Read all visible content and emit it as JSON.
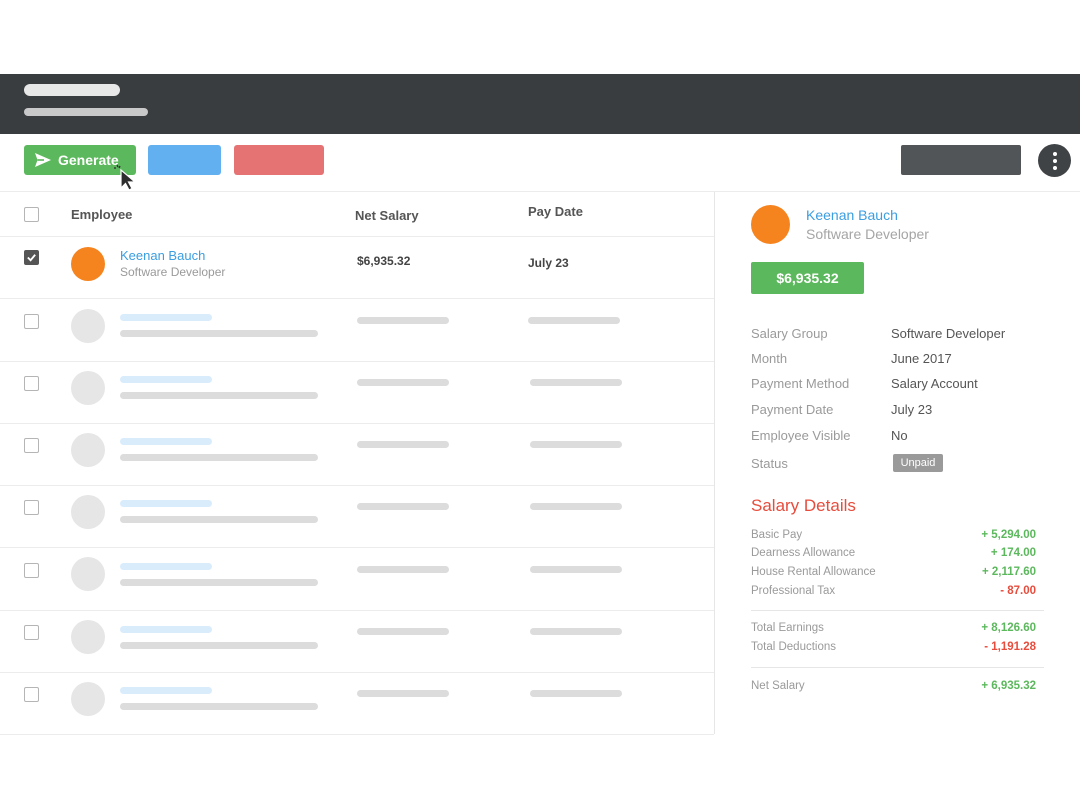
{
  "toolbar": {
    "generate_label": "Generate",
    "primary_color": "#5cb85c",
    "secondary_color": "#62b0f0",
    "danger_color": "#e57373"
  },
  "table": {
    "headers": {
      "employee": "Employee",
      "net_salary": "Net Salary",
      "pay_date": "Pay Date"
    },
    "selected_row": {
      "name": "Keenan Bauch",
      "role": "Software Developer",
      "net_salary": "$6,935.32",
      "pay_date": "July 23",
      "checked": true
    }
  },
  "detail": {
    "name": "Keenan Bauch",
    "role": "Software Developer",
    "amount": "$6,935.32",
    "info": [
      {
        "label": "Salary Group",
        "value": "Software Developer"
      },
      {
        "label": "Month",
        "value": "June 2017"
      },
      {
        "label": "Payment Method",
        "value": "Salary Account"
      },
      {
        "label": "Payment Date",
        "value": "July 23"
      },
      {
        "label": "Employee Visible",
        "value": "No"
      },
      {
        "label": "Status",
        "value": "Unpaid"
      }
    ],
    "salary_details_title": "Salary Details",
    "earnings": [
      {
        "label": "Basic Pay",
        "value": "+ 5,294.00"
      },
      {
        "label": "Dearness Allowance",
        "value": "+ 174.00"
      },
      {
        "label": "House Rental Allowance",
        "value": "+ 2,117.60"
      },
      {
        "label": "Professional Tax",
        "value": "- 87.00"
      }
    ],
    "totals": [
      {
        "label": "Total Earnings",
        "value": "+ 8,126.60"
      },
      {
        "label": "Total Deductions",
        "value": "- 1,191.28"
      }
    ],
    "net": {
      "label": "Net Salary",
      "value": "+ 6,935.32"
    }
  }
}
